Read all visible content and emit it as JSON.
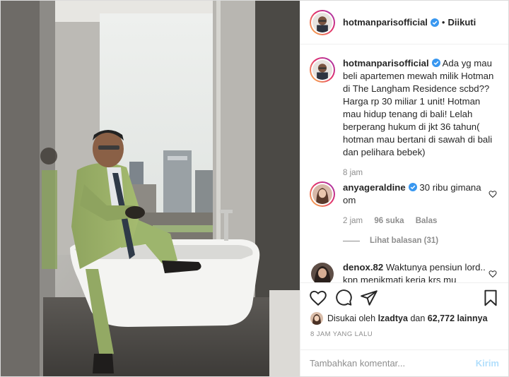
{
  "header": {
    "username": "hotmanparisofficial",
    "separator": "•",
    "follow_status": "Diikuti"
  },
  "caption": {
    "username": "hotmanparisofficial",
    "text": "Ada yg mau beli apartemen mewah milik Hotman di The Langham Residence scbd?? Harga rp 30 miliar 1 unit! Hotman mau hidup tenang di bali! Lelah berperang hukum di jkt 36 tahun( hotman mau bertani di sawah di bali dan pelihara bebek)",
    "time": "8 jam"
  },
  "comments": [
    {
      "username": "anyageraldine",
      "text": "30 ribu gimana om",
      "time": "2 jam",
      "likes": "96 suka",
      "reply_label": "Balas",
      "view_replies": "Lihat balasan (31)"
    },
    {
      "username": "denox.82",
      "text": "Waktunya pensiun lord.. kpn menikmati kerja krs mu"
    }
  ],
  "likes": {
    "prefix": "Disukai oleh",
    "user": "lzadtya",
    "connector": "dan",
    "count": "62,772 lainnya"
  },
  "timestamp": "8 JAM YANG LALU",
  "add_comment": {
    "placeholder": "Tambahkan komentar...",
    "post_label": "Kirim"
  },
  "icons": [
    "verified-badge-icon",
    "heart-icon",
    "comment-icon",
    "share-icon",
    "bookmark-icon"
  ],
  "colors": {
    "accent": "#3897f0",
    "muted": "#8e8e8e",
    "text": "#262626",
    "post_disabled": "#b2dffc"
  }
}
